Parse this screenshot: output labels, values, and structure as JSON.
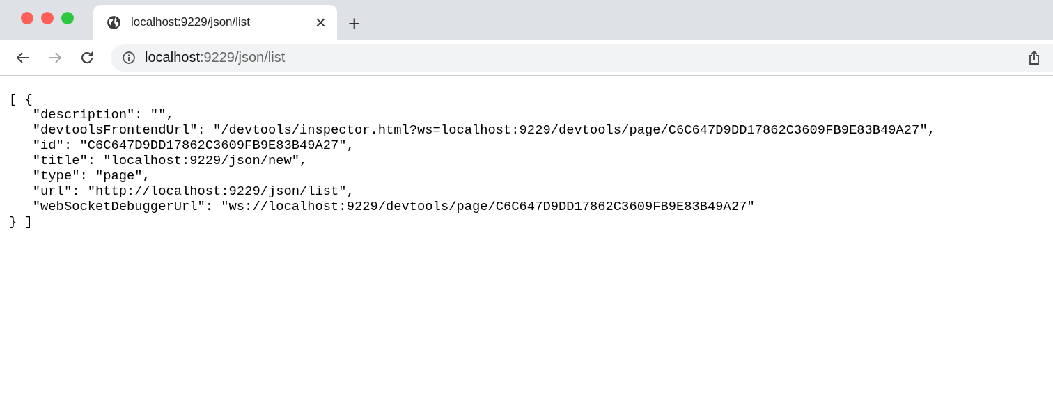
{
  "tab": {
    "title": "localhost:9229/json/list",
    "close": "×",
    "new_tab": "+"
  },
  "address_bar": {
    "host": "localhost",
    "path": ":9229/json/list"
  },
  "content_lines": [
    "[ {",
    "   \"description\": \"\",",
    "   \"devtoolsFrontendUrl\": \"/devtools/inspector.html?ws=localhost:9229/devtools/page/C6C647D9DD17862C3609FB9E83B49A27\",",
    "   \"id\": \"C6C647D9DD17862C3609FB9E83B49A27\",",
    "   \"title\": \"localhost:9229/json/new\",",
    "   \"type\": \"page\",",
    "   \"url\": \"http://localhost:9229/json/list\",",
    "   \"webSocketDebuggerUrl\": \"ws://localhost:9229/devtools/page/C6C647D9DD17862C3609FB9E83B49A27\"",
    "} ]"
  ]
}
